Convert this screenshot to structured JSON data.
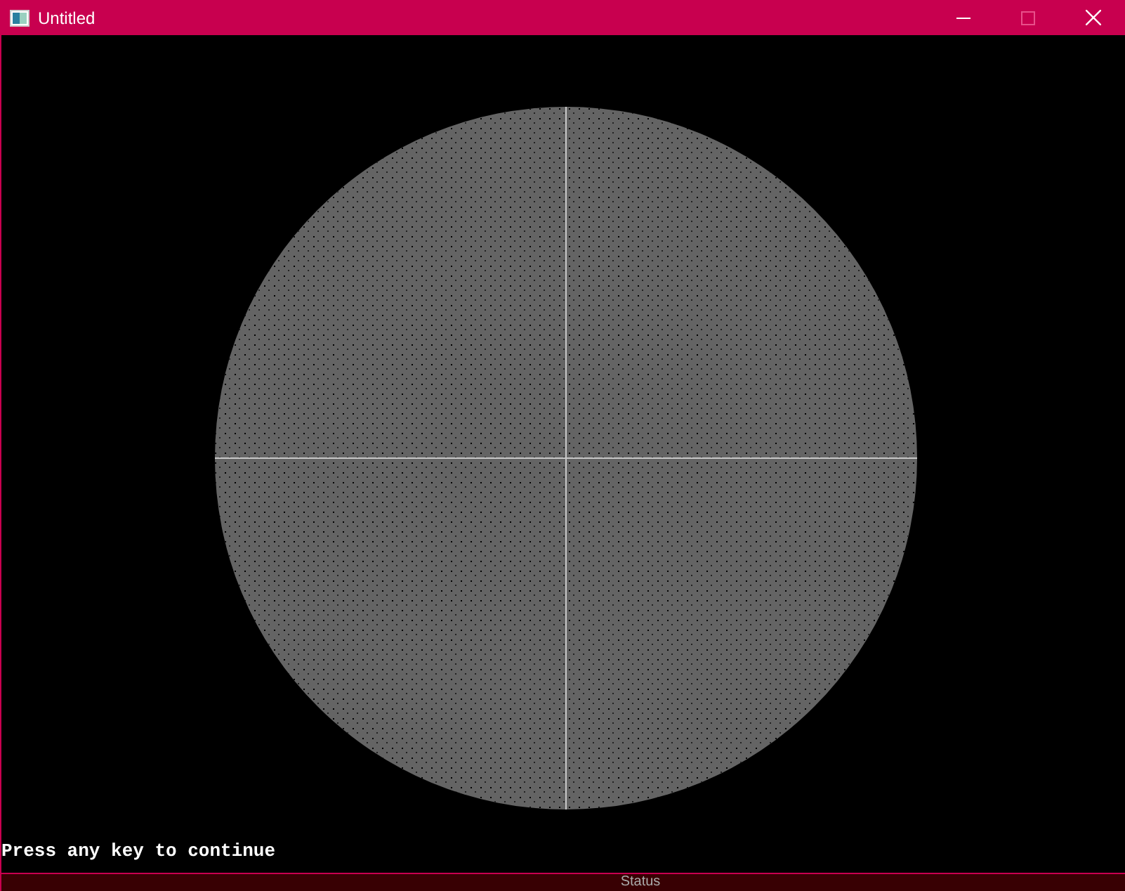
{
  "window": {
    "title": "Untitled"
  },
  "console": {
    "message": "Press any key to continue"
  },
  "status_bar": {
    "text": "Status"
  }
}
